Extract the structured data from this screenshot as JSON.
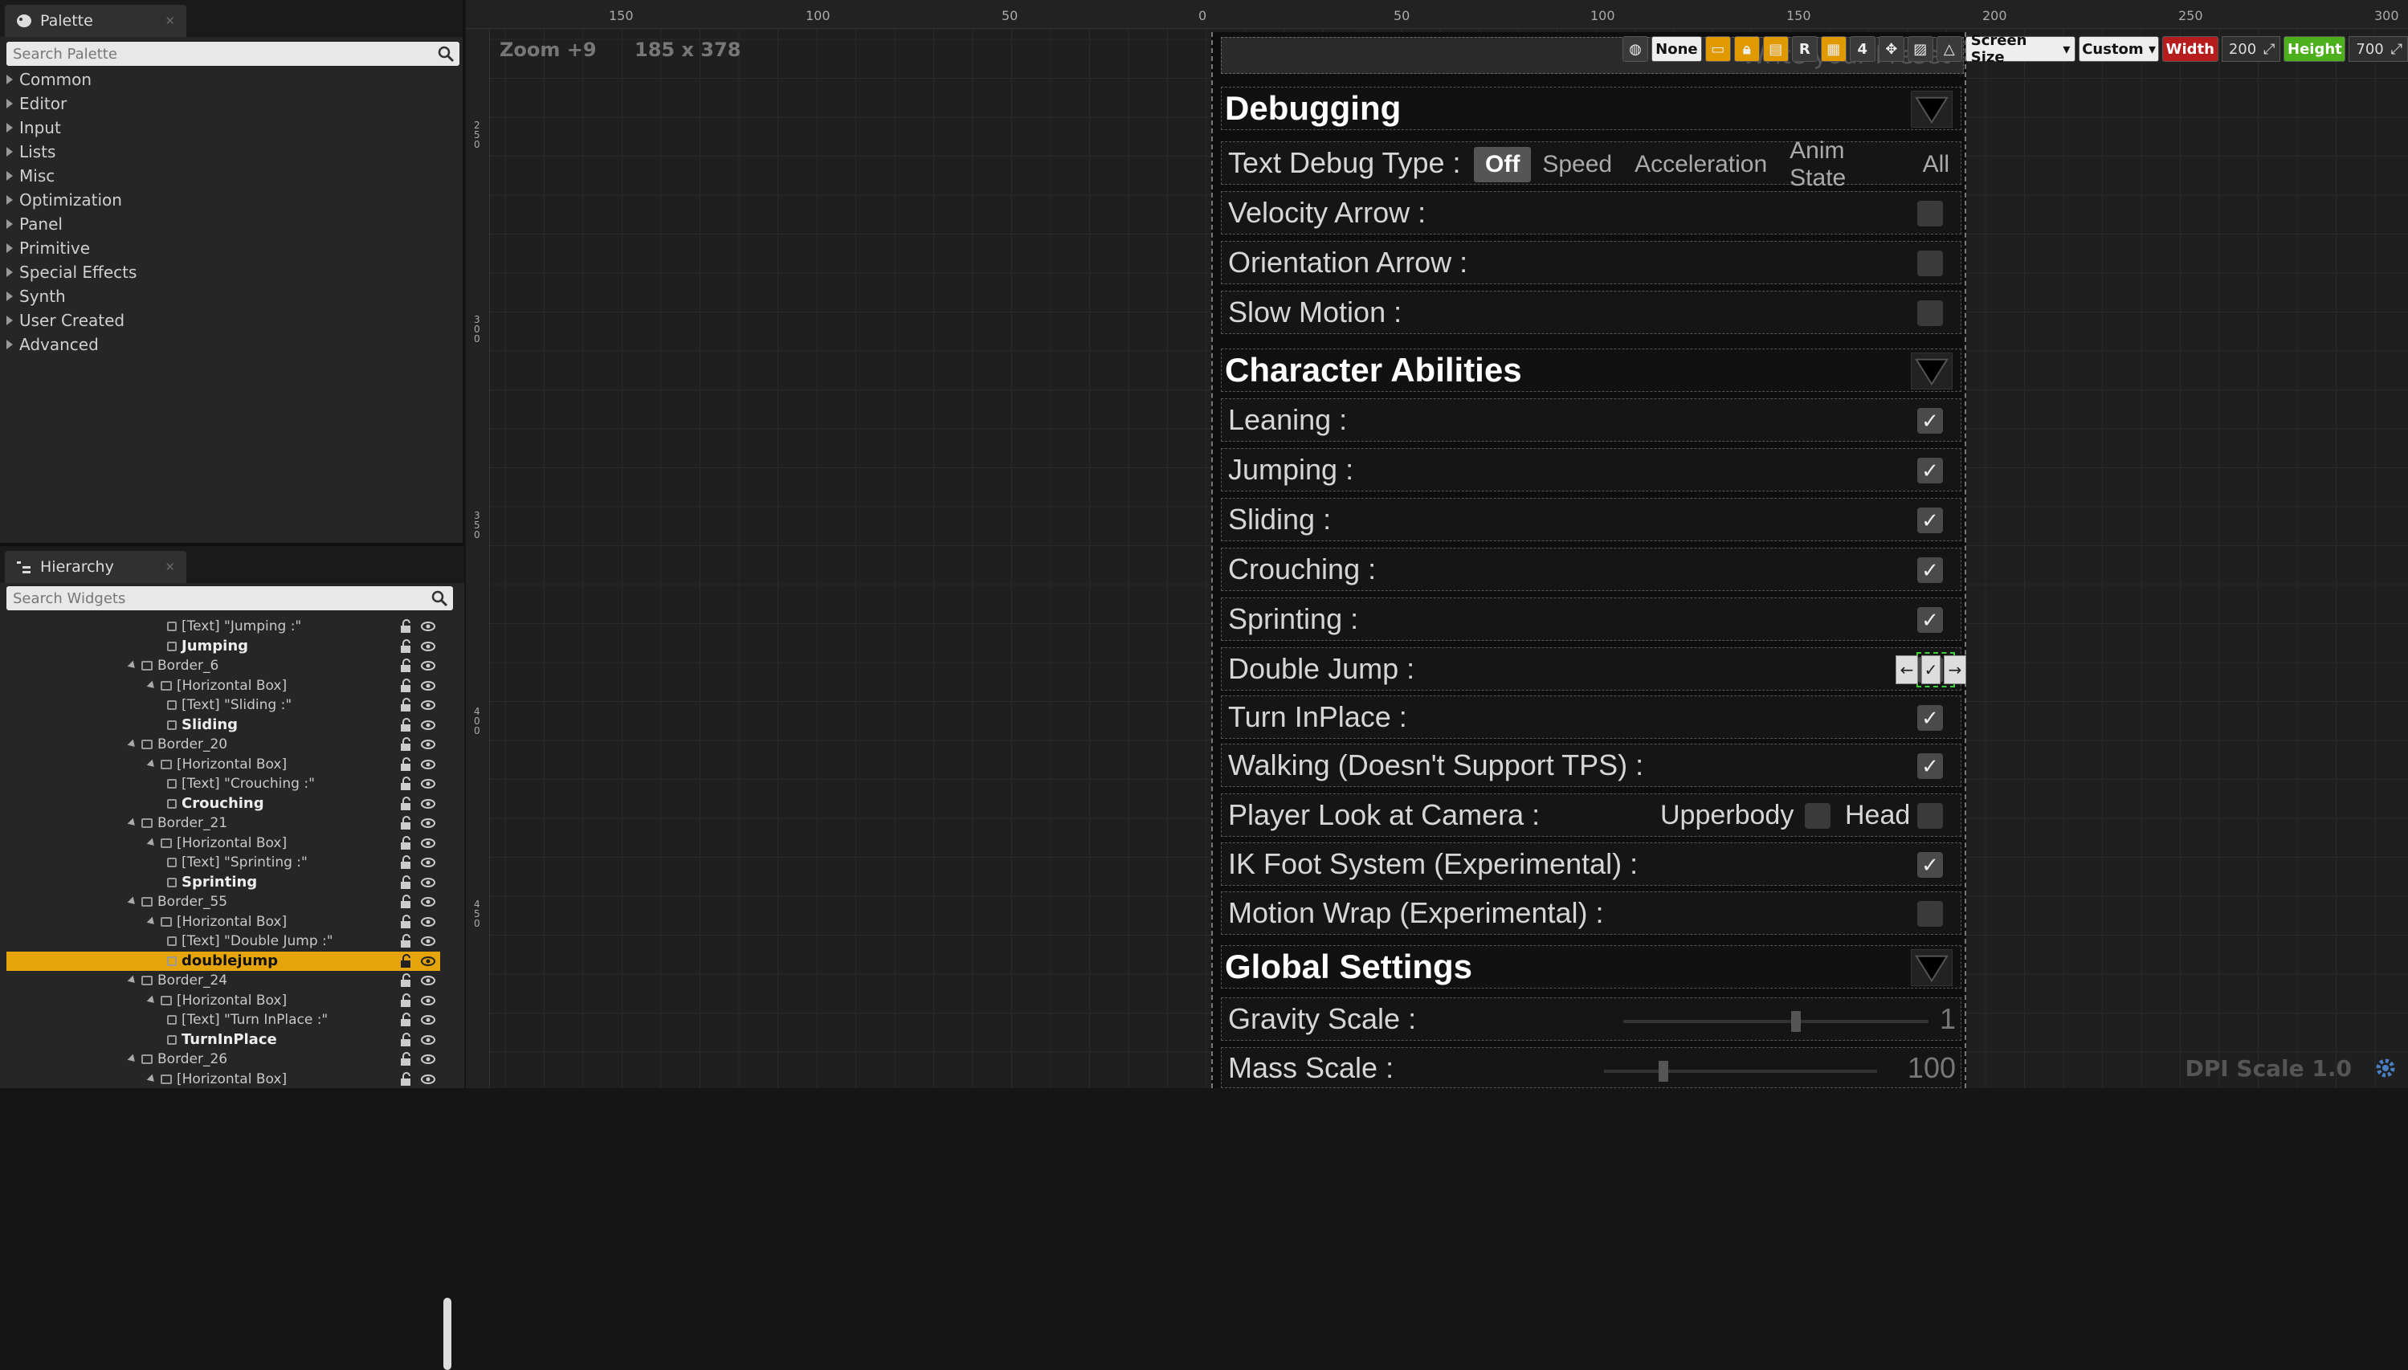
{
  "palette": {
    "tab": "Palette",
    "search_placeholder": "Search Palette",
    "categories": [
      "Common",
      "Editor",
      "Input",
      "Lists",
      "Misc",
      "Optimization",
      "Panel",
      "Primitive",
      "Special Effects",
      "Synth",
      "User Created",
      "Advanced"
    ]
  },
  "hierarchy": {
    "tab": "Hierarchy",
    "search_placeholder": "Search Widgets",
    "rows": [
      {
        "text": "[Text] \"Jumping :\"",
        "indent": 3,
        "kind": "text"
      },
      {
        "text": "Jumping",
        "indent": 3,
        "kind": "check",
        "bold": true
      },
      {
        "text": "Border_6",
        "indent": 1,
        "kind": "border"
      },
      {
        "text": "[Horizontal Box]",
        "indent": 2,
        "kind": "hbox"
      },
      {
        "text": "[Text] \"Sliding :\"",
        "indent": 3,
        "kind": "text"
      },
      {
        "text": "Sliding",
        "indent": 3,
        "kind": "check",
        "bold": true
      },
      {
        "text": "Border_20",
        "indent": 1,
        "kind": "border"
      },
      {
        "text": "[Horizontal Box]",
        "indent": 2,
        "kind": "hbox"
      },
      {
        "text": "[Text] \"Crouching :\"",
        "indent": 3,
        "kind": "text"
      },
      {
        "text": "Crouching",
        "indent": 3,
        "kind": "check",
        "bold": true
      },
      {
        "text": "Border_21",
        "indent": 1,
        "kind": "border"
      },
      {
        "text": "[Horizontal Box]",
        "indent": 2,
        "kind": "hbox"
      },
      {
        "text": "[Text] \"Sprinting :\"",
        "indent": 3,
        "kind": "text"
      },
      {
        "text": "Sprinting",
        "indent": 3,
        "kind": "check",
        "bold": true
      },
      {
        "text": "Border_55",
        "indent": 1,
        "kind": "border"
      },
      {
        "text": "[Horizontal Box]",
        "indent": 2,
        "kind": "hbox"
      },
      {
        "text": "[Text] \"Double Jump :\"",
        "indent": 3,
        "kind": "text"
      },
      {
        "text": "doublejump",
        "indent": 3,
        "kind": "check",
        "bold": true,
        "selected": true
      },
      {
        "text": "Border_24",
        "indent": 1,
        "kind": "border"
      },
      {
        "text": "[Horizontal Box]",
        "indent": 2,
        "kind": "hbox"
      },
      {
        "text": "[Text] \"Turn InPlace :\"",
        "indent": 3,
        "kind": "text"
      },
      {
        "text": "TurnInPlace",
        "indent": 3,
        "kind": "check",
        "bold": true
      },
      {
        "text": "Border_26",
        "indent": 1,
        "kind": "border"
      },
      {
        "text": "[Horizontal Box]",
        "indent": 2,
        "kind": "hbox"
      }
    ]
  },
  "designer": {
    "zoom": "Zoom +9",
    "size": "185 x 378",
    "dpi": "DPI Scale 1.0",
    "ruler_top": [
      "150",
      "100",
      "50",
      "0",
      "50",
      "100",
      "150",
      "200",
      "250",
      "300"
    ],
    "ruler_left": [
      "250",
      "300",
      "350",
      "400",
      "450"
    ],
    "toolbar": {
      "none": "None",
      "r": "R",
      "four": "4",
      "screen_size": "Screen Size",
      "custom": "Custom",
      "width_label": "Width",
      "width_value": "200",
      "height_label": "Height",
      "height_value": "700"
    }
  },
  "widget": {
    "preset_placeholder": "Write your Preset",
    "debugging": "Debugging",
    "text_debug_label": "Text Debug Type :",
    "text_debug_options": [
      "Off",
      "Speed",
      "Acceleration",
      "Anim State",
      "All"
    ],
    "text_debug_selected": "Off",
    "debug_options": [
      {
        "label": "Velocity Arrow :",
        "checked": false
      },
      {
        "label": "Orientation Arrow :",
        "checked": false
      },
      {
        "label": "Slow Motion :",
        "checked": false
      }
    ],
    "abilities": "Character Abilities",
    "ability_options": [
      {
        "label": "Leaning :",
        "checked": true
      },
      {
        "label": "Jumping :",
        "checked": true
      },
      {
        "label": "Sliding :",
        "checked": true
      },
      {
        "label": "Crouching :",
        "checked": true
      },
      {
        "label": "Sprinting :",
        "checked": true
      },
      {
        "label": "Double Jump :",
        "checked": true
      },
      {
        "label": "Turn InPlace :",
        "checked": true
      },
      {
        "label": "Walking (Doesn't Support TPS) :",
        "checked": true
      }
    ],
    "look_label": "Player Look at Camera :",
    "look_upperbody": "Upperbody",
    "look_head": "Head",
    "ik_label": "IK Foot System (Experimental) :",
    "ik_checked": true,
    "motion_label": "Motion Wrap (Experimental) :",
    "motion_checked": false,
    "global": "Global Settings",
    "gravity_label": "Gravity Scale :",
    "gravity_value": "1",
    "gravity_fraction": 0.55,
    "mass_label": "Mass Scale :",
    "mass_value": "100",
    "mass_fraction": 0.2
  }
}
